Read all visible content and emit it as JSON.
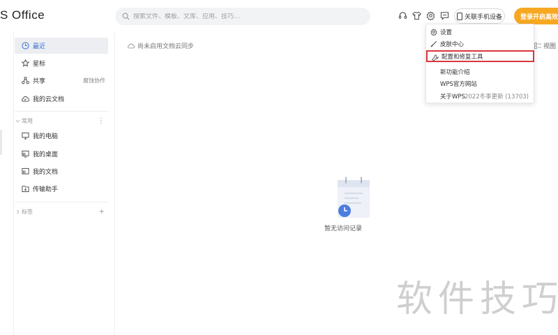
{
  "app": {
    "logo": "S Office"
  },
  "search": {
    "placeholder": "搜索文件、模板、文库、应用、技巧..."
  },
  "header": {
    "phone_button": "关联手机设备",
    "login_button": "登录开启高效办"
  },
  "sidebar": {
    "items": [
      {
        "label": "最近",
        "icon": "clock-icon",
        "active": true
      },
      {
        "label": "星标",
        "icon": "star-icon"
      },
      {
        "label": "共享",
        "icon": "share-icon",
        "extra": "腐蚀协作"
      },
      {
        "label": "我的云文档",
        "icon": "cloud-icon"
      }
    ],
    "common_section": "常用",
    "common_items": [
      {
        "label": "我的电脑",
        "icon": "computer-icon"
      },
      {
        "label": "我的桌面",
        "icon": "desktop-icon"
      },
      {
        "label": "我的文档",
        "icon": "documents-icon"
      },
      {
        "label": "传输助手",
        "icon": "transfer-icon"
      }
    ],
    "tags_section": "标签"
  },
  "main": {
    "sync_note": "尚未启用文档云同步",
    "view_label": "视图",
    "empty_text": "暂无访问记录",
    "watermark": "软件技巧"
  },
  "menu": {
    "items": [
      {
        "label": "设置",
        "icon": "gear-icon"
      },
      {
        "label": "皮肤中心",
        "icon": "brush-icon"
      },
      {
        "label": "配置和修复工具",
        "icon": "wrench-icon",
        "highlighted": true
      },
      {
        "label": "新功能介绍"
      },
      {
        "label": "WPS官方网站"
      },
      {
        "label": "关于WPS",
        "version": "2022冬季更新 (13703)"
      }
    ]
  },
  "colors": {
    "accent": "#3a6fd8",
    "login": "#f7a823",
    "highlight_border": "#d9363e"
  }
}
